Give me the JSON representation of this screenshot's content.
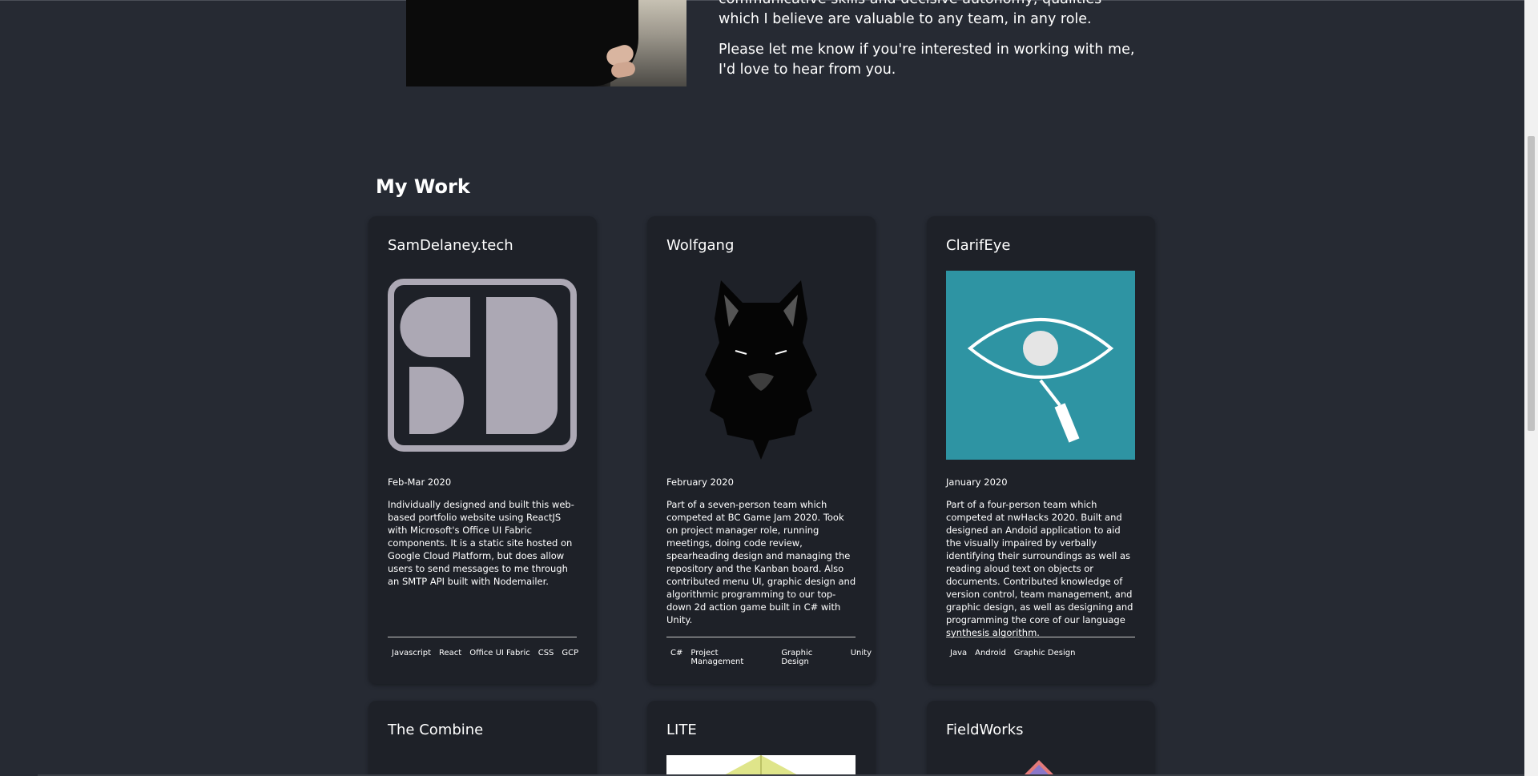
{
  "bio": {
    "paragraph_1": "communicative skills and decisive autonomy, qualities which I believe are valuable to any team, in any role.",
    "paragraph_2": "Please let me know if you're interested in working with me, I'd love to hear from you."
  },
  "work": {
    "title": "My Work",
    "projects": [
      {
        "title": "SamDelaney.tech",
        "date": "Feb-Mar 2020",
        "description": "Individually designed and built this web-based portfolio website using ReactJS with Microsoft's Office UI Fabric components. It is a static site hosted on Google Cloud Platform, but does allow users to send messages to me through an SMTP API built with Nodemailer.",
        "tags": [
          "Javascript",
          "React",
          "Office UI Fabric",
          "CSS",
          "GCP"
        ]
      },
      {
        "title": "Wolfgang",
        "date": "February 2020",
        "description": "Part of a seven-person team which competed at BC Game Jam 2020. Took on project manager role, running meetings, doing code review, spearheading design and managing the repository and the Kanban board. Also contributed menu UI, graphic design and algorithmic programming to our top-down 2d action game built in C# with Unity.",
        "tags": [
          "C#",
          "Project Management",
          "Graphic Design",
          "Unity"
        ]
      },
      {
        "title": "ClarifEye",
        "date": "January 2020",
        "description": "Part of a four-person team which competed at nwHacks 2020. Built and designed an Andoid application to aid the visually impaired by verbally identifying their surroundings as well as reading aloud text on objects or documents. Contributed knowledge of version control, team management, and graphic design, as well as designing and programming the core of our language synthesis algorithm.",
        "tags": [
          "Java",
          "Android",
          "Graphic Design"
        ]
      },
      {
        "title": "The Combine"
      },
      {
        "title": "LITE"
      },
      {
        "title": "FieldWorks"
      }
    ]
  },
  "colors": {
    "background": "#262a33",
    "card": "#1e2128",
    "clarifeye_teal": "#2e94a3",
    "sd_logo_gray": "#aca8b4"
  },
  "icons": [
    "samdelaney-logo",
    "wolf-logo",
    "eye-magnifier-logo"
  ]
}
